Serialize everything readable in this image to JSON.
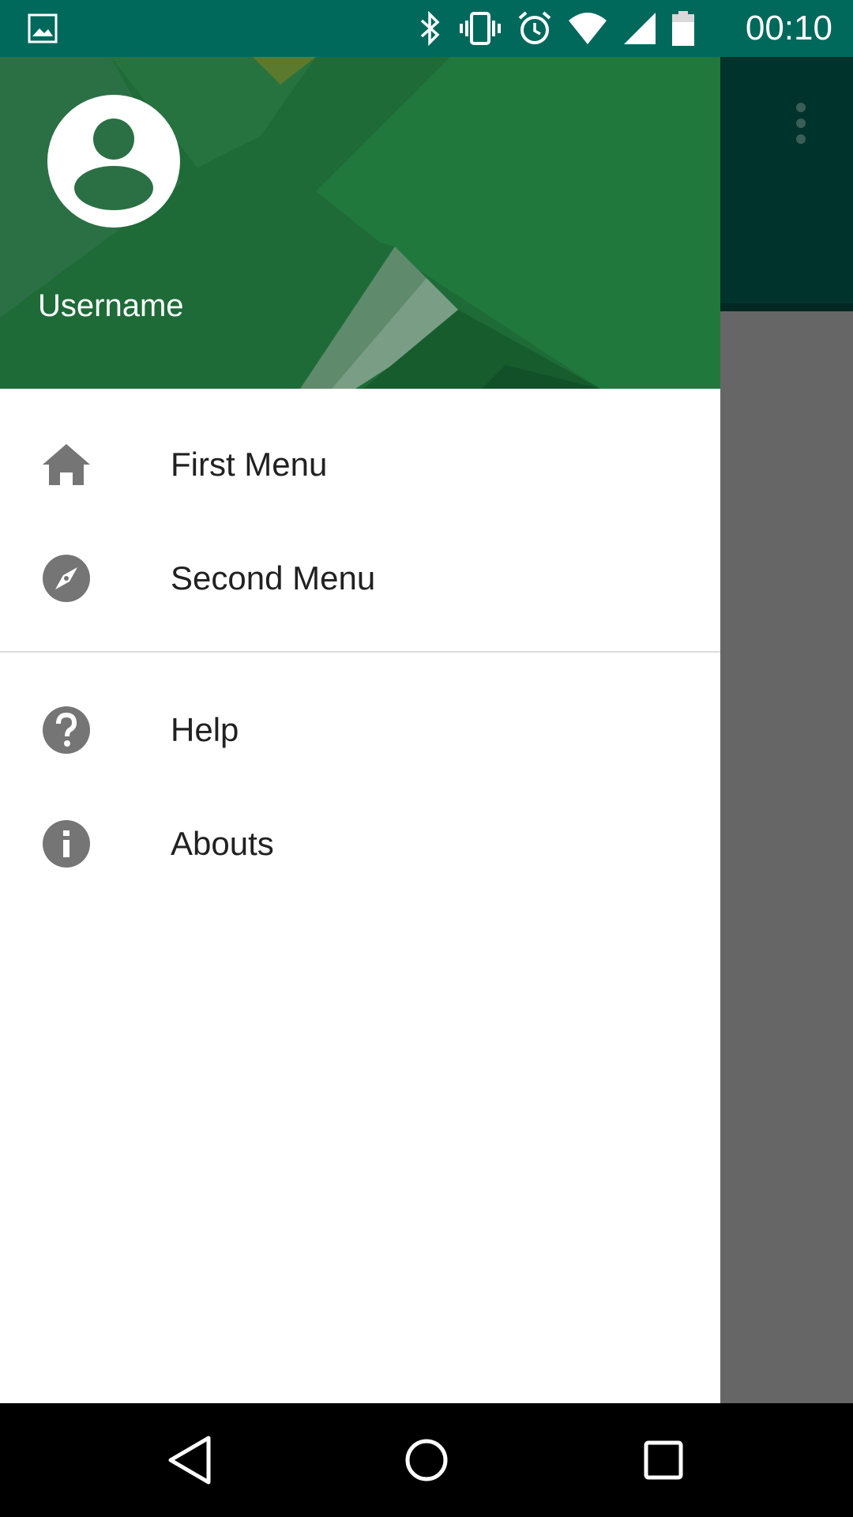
{
  "status_bar": {
    "time": "00:10",
    "icons": [
      "image-notification-icon",
      "bluetooth-icon",
      "vibrate-icon",
      "alarm-icon",
      "wifi-icon",
      "cell-signal-icon",
      "battery-icon"
    ]
  },
  "drawer": {
    "header": {
      "username": "Username"
    },
    "menu": [
      {
        "label": "First Menu",
        "icon": "home-icon"
      },
      {
        "label": "Second Menu",
        "icon": "compass-icon"
      }
    ],
    "secondary_menu": [
      {
        "label": "Help",
        "icon": "help-icon"
      },
      {
        "label": "Abouts",
        "icon": "info-icon"
      }
    ]
  },
  "background_app": {
    "toolbar_icon": "overflow-menu-icon"
  },
  "nav_bar": {
    "buttons": [
      "back-icon",
      "home-circle-icon",
      "recents-icon"
    ]
  },
  "colors": {
    "status_bar": "#00695c",
    "header_green": "#1f6e3a",
    "icon_gray": "#757575",
    "scrim": "#666666"
  }
}
